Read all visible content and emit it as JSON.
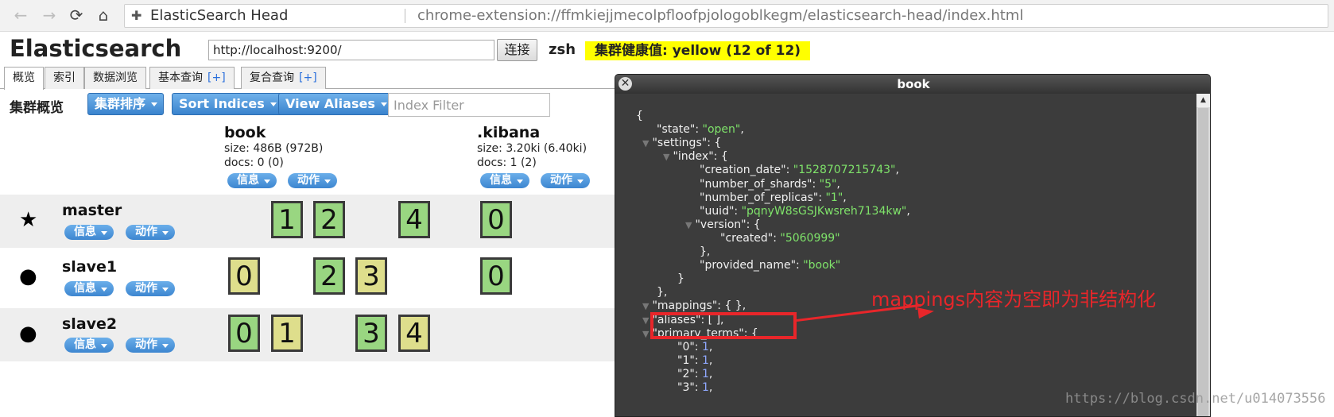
{
  "browser": {
    "extension_name": "ElasticSearch Head",
    "url": "chrome-extension://ffmkiejjmecolpfloofpjologoblkegm/elasticsearch-head/index.html"
  },
  "header": {
    "title": "Elasticsearch",
    "connection_url": "http://localhost:9200/",
    "connect_label": "连接",
    "cluster_name": "zsh",
    "health_text": "集群健康值: yellow (12 of 12)",
    "health_color": "#ffff00"
  },
  "tabs": [
    {
      "label": "概览",
      "plus": ""
    },
    {
      "label": "索引",
      "plus": ""
    },
    {
      "label": "数据浏览",
      "plus": ""
    },
    {
      "label": "基本查询",
      "plus": "[+]"
    },
    {
      "label": "复合查询",
      "plus": "[+]"
    }
  ],
  "toolbar": {
    "overview_label": "集群概览",
    "sort_cluster": "集群排序",
    "sort_indices": "Sort Indices",
    "view_aliases": "View Aliases",
    "index_filter_placeholder": "Index Filter"
  },
  "indices": [
    {
      "name": "book",
      "size": "size: 486B (972B)",
      "docs": "docs: 0 (0)",
      "info_label": "信息",
      "action_label": "动作"
    },
    {
      "name": ".kibana",
      "size": "size: 3.20ki (6.40ki)",
      "docs": "docs: 1 (2)",
      "info_label": "信息",
      "action_label": "动作"
    }
  ],
  "nodes": [
    {
      "name": "master",
      "icon": "star-icon",
      "info_label": "信息",
      "action_label": "动作",
      "book_shards": [
        {
          "n": "1",
          "type": "primary"
        },
        {
          "n": "2",
          "type": "primary"
        },
        {
          "n": "4",
          "type": "primary"
        }
      ],
      "kibana_shards": [
        {
          "n": "0",
          "type": "primary"
        }
      ]
    },
    {
      "name": "slave1",
      "icon": "circle-icon",
      "info_label": "信息",
      "action_label": "动作",
      "book_shards": [
        {
          "n": "0",
          "type": "replica"
        },
        {
          "n": "2",
          "type": "primary"
        },
        {
          "n": "3",
          "type": "replica"
        }
      ],
      "kibana_shards": [
        {
          "n": "0",
          "type": "primary"
        }
      ]
    },
    {
      "name": "slave2",
      "icon": "circle-icon",
      "info_label": "信息",
      "action_label": "动作",
      "book_shards": [
        {
          "n": "0",
          "type": "primary"
        },
        {
          "n": "1",
          "type": "replica"
        },
        {
          "n": "3",
          "type": "primary"
        },
        {
          "n": "4",
          "type": "replica"
        }
      ],
      "kibana_shards": []
    }
  ],
  "colors": {
    "primary_shard": "#99d681",
    "replica_shard": "#dede8c",
    "annotation": "#e8262a",
    "json_string": "#7fe36a",
    "json_number": "#8fa8ff"
  },
  "dialog": {
    "title": "book",
    "close_glyph": "✕",
    "lines": [
      {
        "text": "{",
        "indent": 0
      },
      {
        "key": "\"state\"",
        "value": "\"open\"",
        "vtype": "str",
        "suffix": ",",
        "indent": 1
      },
      {
        "key": "\"settings\"",
        "value": "{",
        "vtype": "plain",
        "suffix": "",
        "indent": 1,
        "tri": true
      },
      {
        "key": "\"index\"",
        "value": "{",
        "vtype": "plain",
        "suffix": "",
        "indent": 2,
        "tri": true
      },
      {
        "key": "\"creation_date\"",
        "value": "\"1528707215743\"",
        "vtype": "str",
        "suffix": ",",
        "indent": 3
      },
      {
        "key": "\"number_of_shards\"",
        "value": "\"5\"",
        "vtype": "str",
        "suffix": ",",
        "indent": 3
      },
      {
        "key": "\"number_of_replicas\"",
        "value": "\"1\"",
        "vtype": "str",
        "suffix": ",",
        "indent": 3
      },
      {
        "key": "\"uuid\"",
        "value": "\"pqnyW8sGSJKwsreh7134kw\"",
        "vtype": "str",
        "suffix": ",",
        "indent": 3
      },
      {
        "key": "\"version\"",
        "value": "{",
        "vtype": "plain",
        "suffix": "",
        "indent": 3,
        "tri": true
      },
      {
        "key": "\"created\"",
        "value": "\"5060999\"",
        "vtype": "str",
        "suffix": "",
        "indent": 4
      },
      {
        "text": "},",
        "indent": 3
      },
      {
        "key": "\"provided_name\"",
        "value": "\"book\"",
        "vtype": "str",
        "suffix": "",
        "indent": 3
      },
      {
        "text": "}",
        "indent": 2
      },
      {
        "text": "},",
        "indent": 1
      },
      {
        "key": "\"mappings\"",
        "value": "{ }",
        "vtype": "plain",
        "suffix": ",",
        "indent": 1,
        "tri": true
      },
      {
        "key": "\"aliases\"",
        "value": "[ ]",
        "vtype": "plain",
        "suffix": ",",
        "indent": 1,
        "tri": true
      },
      {
        "key": "\"primary_terms\"",
        "value": "{",
        "vtype": "plain",
        "suffix": "",
        "indent": 1,
        "tri": true
      },
      {
        "key": "\"0\"",
        "value": "1",
        "vtype": "num",
        "suffix": ",",
        "indent": 2
      },
      {
        "key": "\"1\"",
        "value": "1",
        "vtype": "num",
        "suffix": ",",
        "indent": 2
      },
      {
        "key": "\"2\"",
        "value": "1",
        "vtype": "num",
        "suffix": ",",
        "indent": 2
      },
      {
        "key": "\"3\"",
        "value": "1",
        "vtype": "num",
        "suffix": ",",
        "indent": 2
      }
    ]
  },
  "annotation": {
    "text": "mappings内容为空即为非结构化"
  },
  "watermark": "https://blog.csdn.net/u014073556"
}
